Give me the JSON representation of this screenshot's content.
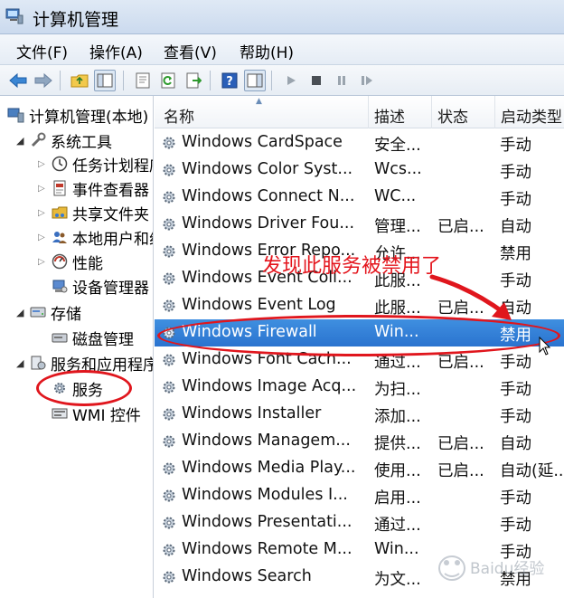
{
  "window": {
    "title": "计算机管理"
  },
  "menu": [
    "文件(F)",
    "操作(A)",
    "查看(V)",
    "帮助(H)"
  ],
  "toolbar_icons": [
    "back-icon",
    "forward-icon",
    "up-folder-icon",
    "show-hide-tree-icon",
    "properties-icon",
    "refresh-icon",
    "export-list-icon",
    "help-icon",
    "show-hide-action-pane-icon",
    "play-icon",
    "stop-icon",
    "pause-icon",
    "restart-icon"
  ],
  "tree": {
    "root": "计算机管理(本地)",
    "system_tools": "系统工具",
    "task_scheduler": "任务计划程序",
    "event_viewer": "事件查看器",
    "shared_folders": "共享文件夹",
    "local_users": "本地用户和组",
    "performance": "性能",
    "device_manager": "设备管理器",
    "storage": "存储",
    "disk_management": "磁盘管理",
    "services_apps": "服务和应用程序",
    "services": "服务",
    "wmi": "WMI 控件"
  },
  "columns": {
    "name": "名称",
    "description": "描述",
    "status": "状态",
    "startup": "启动类型"
  },
  "services": [
    {
      "name": "Windows CardSpace",
      "description": "安全...",
      "status": "",
      "startup": "手动"
    },
    {
      "name": "Windows Color Syst...",
      "description": "Wcs...",
      "status": "",
      "startup": "手动"
    },
    {
      "name": "Windows Connect N...",
      "description": "WC...",
      "status": "",
      "startup": "手动"
    },
    {
      "name": "Windows Driver Fou...",
      "description": "管理...",
      "status": "已启...",
      "startup": "自动"
    },
    {
      "name": "Windows Error Repo...",
      "description": "允许...",
      "status": "",
      "startup": "禁用"
    },
    {
      "name": "Windows Event Coll...",
      "description": "此服...",
      "status": "",
      "startup": "手动"
    },
    {
      "name": "Windows Event Log",
      "description": "此服...",
      "status": "已启...",
      "startup": "自动"
    },
    {
      "name": "Windows Firewall",
      "description": "Win...",
      "status": "",
      "startup": "禁用",
      "selected": true
    },
    {
      "name": "Windows Font Cach...",
      "description": "通过...",
      "status": "已启...",
      "startup": "手动"
    },
    {
      "name": "Windows Image Acq...",
      "description": "为扫...",
      "status": "",
      "startup": "手动"
    },
    {
      "name": "Windows Installer",
      "description": "添加...",
      "status": "",
      "startup": "手动"
    },
    {
      "name": "Windows Managem...",
      "description": "提供...",
      "status": "已启...",
      "startup": "自动"
    },
    {
      "name": "Windows Media Play...",
      "description": "使用...",
      "status": "已启...",
      "startup": "自动(延..."
    },
    {
      "name": "Windows Modules I...",
      "description": "启用...",
      "status": "",
      "startup": "手动"
    },
    {
      "name": "Windows Presentati...",
      "description": "通过...",
      "status": "",
      "startup": "手动"
    },
    {
      "name": "Windows Remote M...",
      "description": "Win...",
      "status": "",
      "startup": "手动"
    },
    {
      "name": "Windows Search",
      "description": "为文...",
      "status": "",
      "startup": "禁用"
    }
  ],
  "annotation": {
    "text": "发现此服务被禁用了",
    "color": "#e4141c"
  },
  "watermark": "Baidu经验",
  "colors": {
    "selection": "#2f7fd8",
    "annotation_red": "#e0161d"
  }
}
